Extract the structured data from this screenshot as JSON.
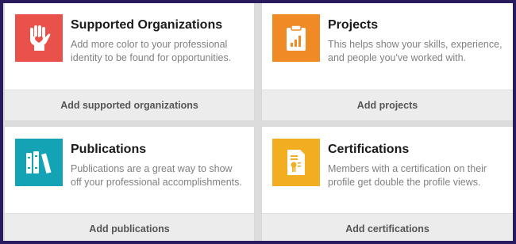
{
  "colors": {
    "supported_organizations": "#e8524a",
    "projects": "#ef8a24",
    "publications": "#13a3b4",
    "certifications": "#f2ad21"
  },
  "cards": [
    {
      "icon": "heart-hand-icon",
      "title": "Supported Organizations",
      "description": "Add more color to your professional identity to be found for opportunities.",
      "action": "Add supported organizations"
    },
    {
      "icon": "clipboard-chart-icon",
      "title": "Projects",
      "description": "This helps show your skills, experience, and people you've worked with.",
      "action": "Add projects"
    },
    {
      "icon": "books-icon",
      "title": "Publications",
      "description": "Publications are a great way to show off your professional accomplishments.",
      "action": "Add publications"
    },
    {
      "icon": "certificate-icon",
      "title": "Certifications",
      "description": "Members with a certification on their profile get double the profile views.",
      "action": "Add certifications"
    }
  ]
}
